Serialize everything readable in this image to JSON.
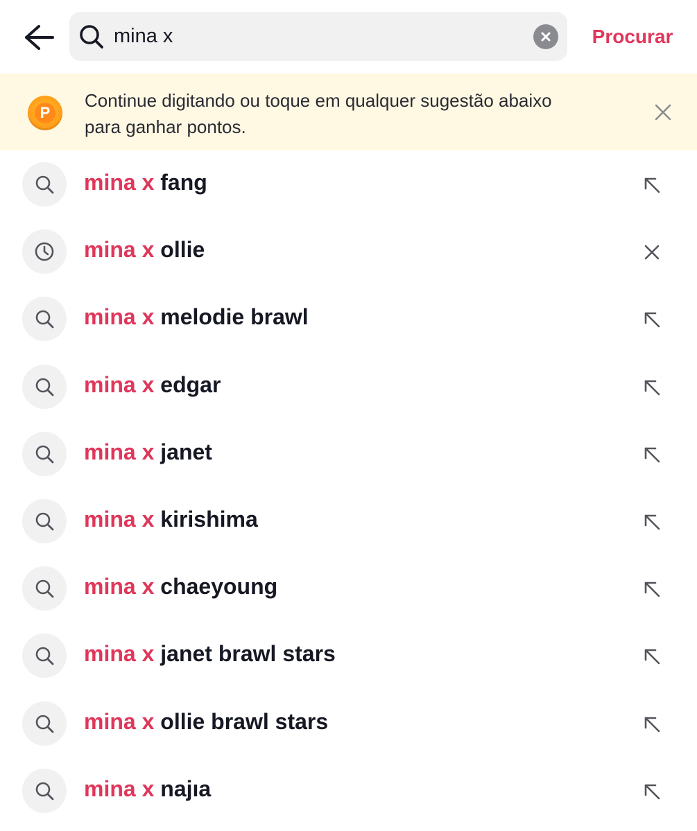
{
  "search": {
    "value": "mina x",
    "placeholder": "",
    "submit_label": "Procurar"
  },
  "banner": {
    "coin_letter": "P",
    "text": "Continue digitando ou toque em qualquer sugestão abaixo para ganhar pontos."
  },
  "colors": {
    "accent": "#e0365a",
    "banner_bg": "#fff9e4",
    "icon_bg": "#f1f1f2"
  },
  "suggestions": [
    {
      "highlight": "mina x",
      "rest": "fang",
      "icon": "search-icon",
      "action": "fill-arrow-icon"
    },
    {
      "highlight": "mina x",
      "rest": "ollie",
      "icon": "clock-icon",
      "action": "close-icon"
    },
    {
      "highlight": "mina x",
      "rest": "melodie brawl",
      "icon": "search-icon",
      "action": "fill-arrow-icon"
    },
    {
      "highlight": "mina x",
      "rest": "edgar",
      "icon": "search-icon",
      "action": "fill-arrow-icon"
    },
    {
      "highlight": "mina x",
      "rest": "janet",
      "icon": "search-icon",
      "action": "fill-arrow-icon"
    },
    {
      "highlight": "mina x",
      "rest": "kirishima",
      "icon": "search-icon",
      "action": "fill-arrow-icon"
    },
    {
      "highlight": "mina x",
      "rest": "chaeyoung",
      "icon": "search-icon",
      "action": "fill-arrow-icon"
    },
    {
      "highlight": "mina x",
      "rest": "janet brawl stars",
      "icon": "search-icon",
      "action": "fill-arrow-icon"
    },
    {
      "highlight": "mina x",
      "rest": "ollie brawl stars",
      "icon": "search-icon",
      "action": "fill-arrow-icon"
    },
    {
      "highlight": "mina x",
      "rest": "najıa",
      "icon": "search-icon",
      "action": "fill-arrow-icon"
    }
  ]
}
